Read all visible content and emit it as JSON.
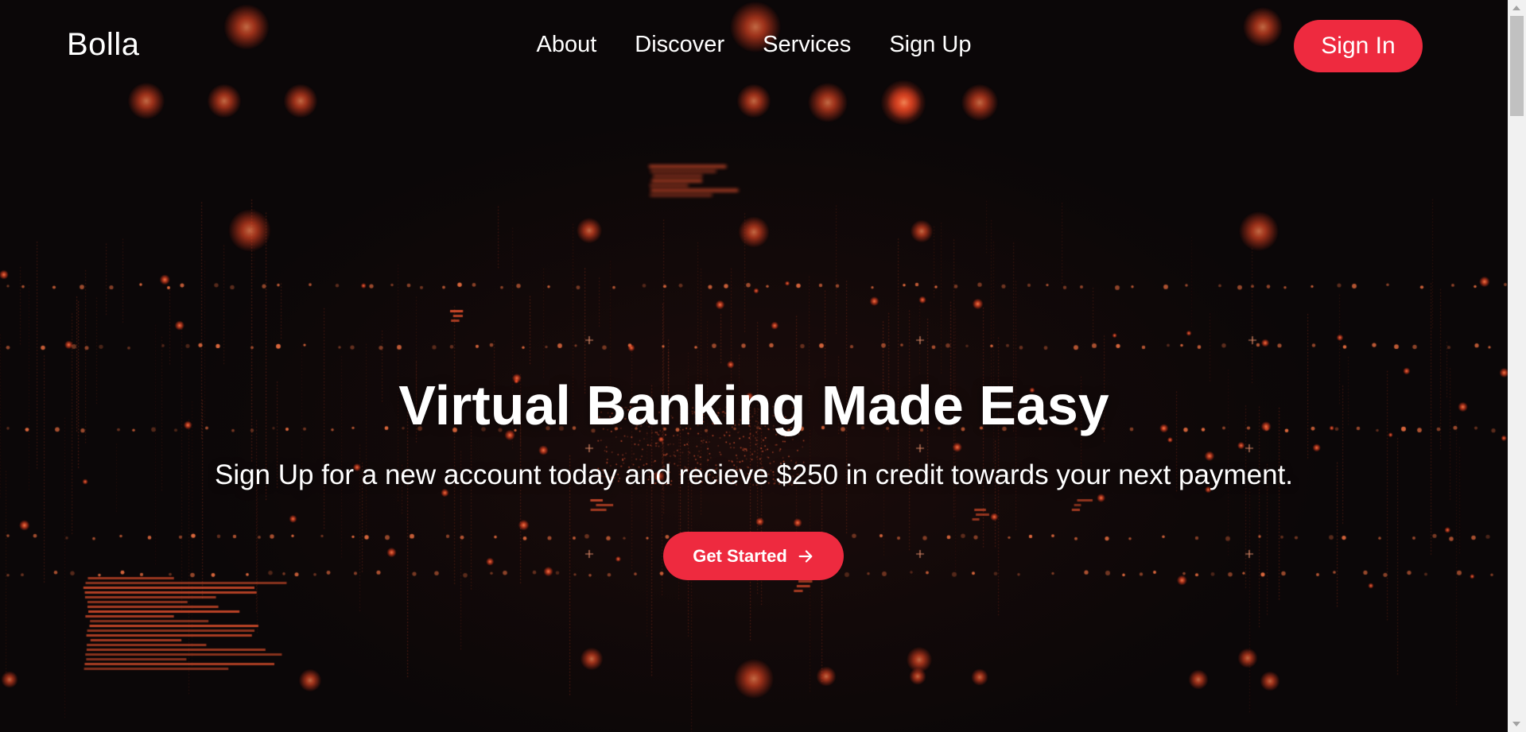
{
  "brand": {
    "name": "Bolla"
  },
  "nav": {
    "items": [
      {
        "label": "About"
      },
      {
        "label": "Discover"
      },
      {
        "label": "Services"
      },
      {
        "label": "Sign Up"
      }
    ],
    "signin_label": "Sign In"
  },
  "hero": {
    "title": "Virtual Banking Made Easy",
    "subtitle": "Sign Up for a new account today and recieve $250 in credit towards your next payment.",
    "cta_label": "Get Started",
    "cta_icon": "arrow-right-icon",
    "background": "dark-data-particles-image"
  },
  "colors": {
    "accent": "#ee2a3f",
    "background": "#0b0708",
    "glow": "#ff5a36",
    "text": "#ffffff"
  }
}
